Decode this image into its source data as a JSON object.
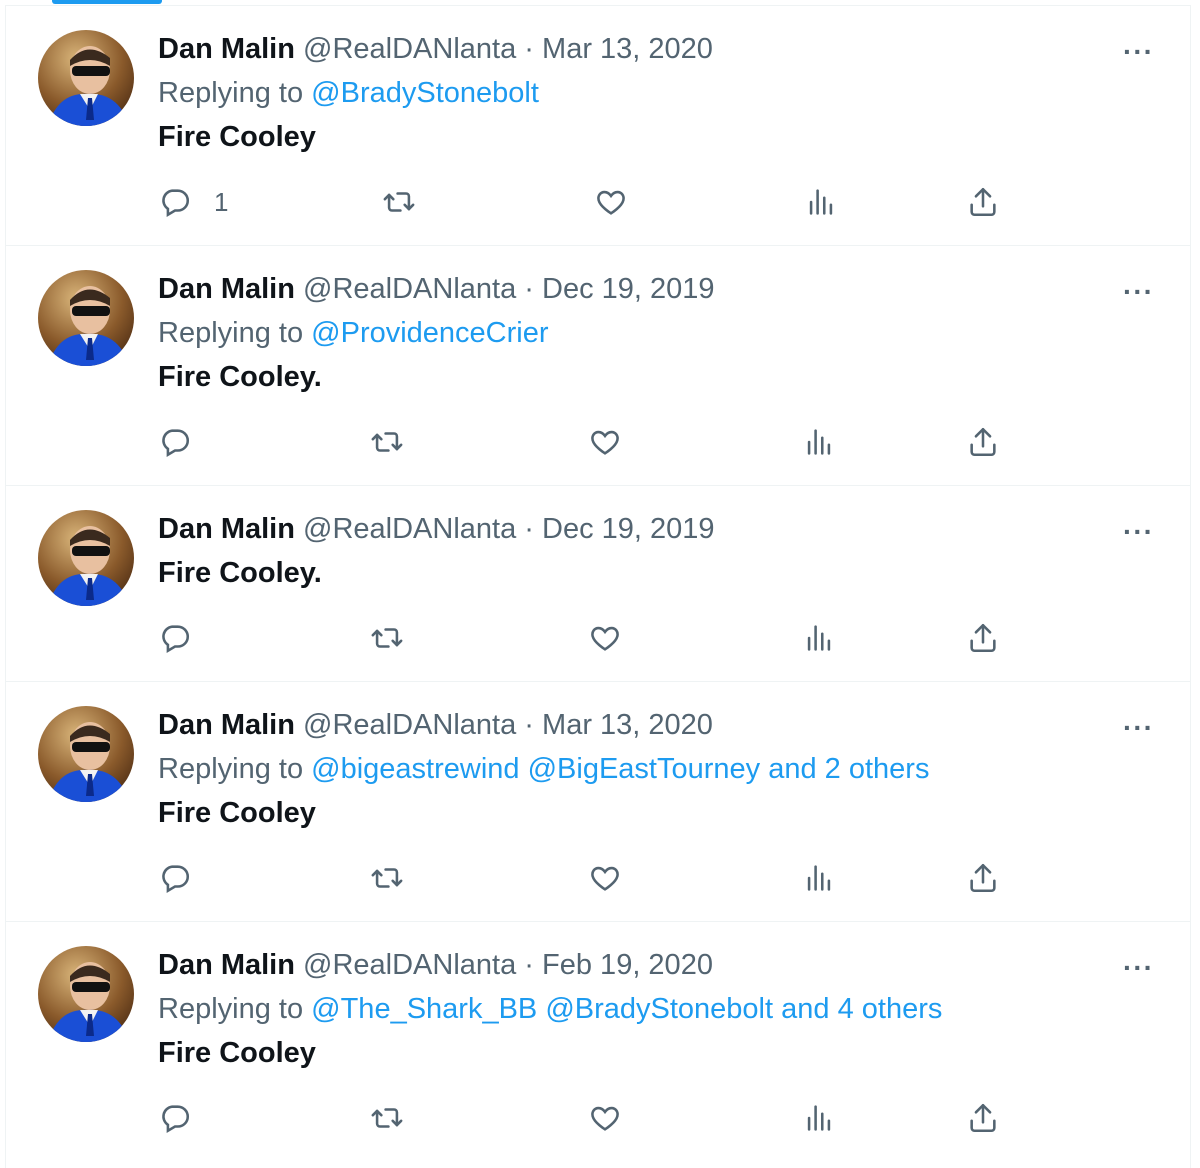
{
  "tweets": [
    {
      "name": "Dan Malin",
      "handle": "@RealDANlanta",
      "separator": "·",
      "date": "Mar 13, 2020",
      "replying_prefix": "Replying to",
      "replying_to": "@BradyStonebolt",
      "replying_more": "",
      "text": "Fire Cooley",
      "reply_count": "1"
    },
    {
      "name": "Dan Malin",
      "handle": "@RealDANlanta",
      "separator": "·",
      "date": "Dec 19, 2019",
      "replying_prefix": "Replying to",
      "replying_to": "@ProvidenceCrier",
      "replying_more": "",
      "text": "Fire Cooley.",
      "reply_count": ""
    },
    {
      "name": "Dan Malin",
      "handle": "@RealDANlanta",
      "separator": "·",
      "date": "Dec 19, 2019",
      "replying_prefix": "",
      "replying_to": "",
      "replying_more": "",
      "text": "Fire Cooley.",
      "reply_count": ""
    },
    {
      "name": "Dan Malin",
      "handle": "@RealDANlanta",
      "separator": "·",
      "date": "Mar 13, 2020",
      "replying_prefix": "Replying to",
      "replying_to": "@bigeastrewind @BigEastTourney",
      "replying_more": "and 2 others",
      "text": "Fire Cooley",
      "reply_count": ""
    },
    {
      "name": "Dan Malin",
      "handle": "@RealDANlanta",
      "separator": "·",
      "date": "Feb 19, 2020",
      "replying_prefix": "Replying to",
      "replying_to": "@The_Shark_BB @BradyStonebolt",
      "replying_more": "and 4 others",
      "text": "Fire Cooley",
      "reply_count": ""
    }
  ],
  "more_glyph": "···",
  "icons": [
    "reply-icon",
    "retweet-icon",
    "like-icon",
    "views-icon",
    "share-icon"
  ],
  "colors": {
    "text": "#0f1419",
    "muted": "#536471",
    "link": "#1d9bf0",
    "border": "#eff3f4"
  }
}
